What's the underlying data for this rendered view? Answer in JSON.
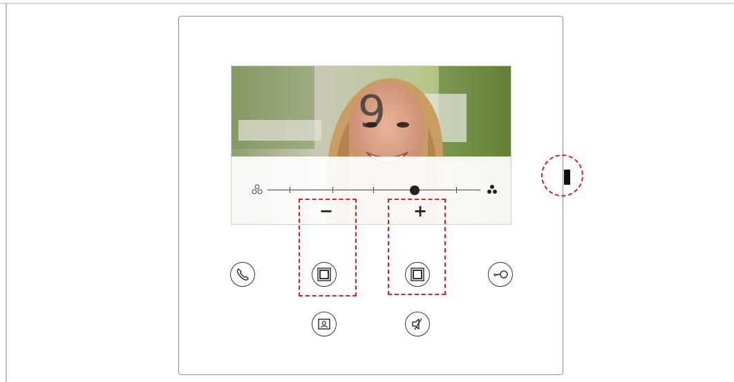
{
  "screen": {
    "volume_number": "9",
    "minus_label": "−",
    "plus_label": "+",
    "slider": {
      "min_icon": "brightness-low-icon",
      "max_icon": "brightness-high-icon",
      "level": 0.72,
      "ticks": 5
    }
  },
  "buttons": [
    {
      "name": "call-button",
      "icon": "phone-handset-icon"
    },
    {
      "name": "minus-button",
      "icon": "square-frame-icon"
    },
    {
      "name": "plus-button",
      "icon": "square-frame-icon"
    },
    {
      "name": "door-lock-button",
      "icon": "key-icon"
    },
    {
      "name": "camera-view-button",
      "icon": "user-portrait-icon"
    },
    {
      "name": "mute-button",
      "icon": "speaker-mute-icon"
    }
  ],
  "annotations": {
    "highlight_color": "#e01b24",
    "highlighted": [
      "minus-button",
      "plus-button",
      "side-switch"
    ]
  },
  "colors": {
    "device_border": "#8e8e8e",
    "icon": "#333333",
    "knob": "#222222"
  }
}
